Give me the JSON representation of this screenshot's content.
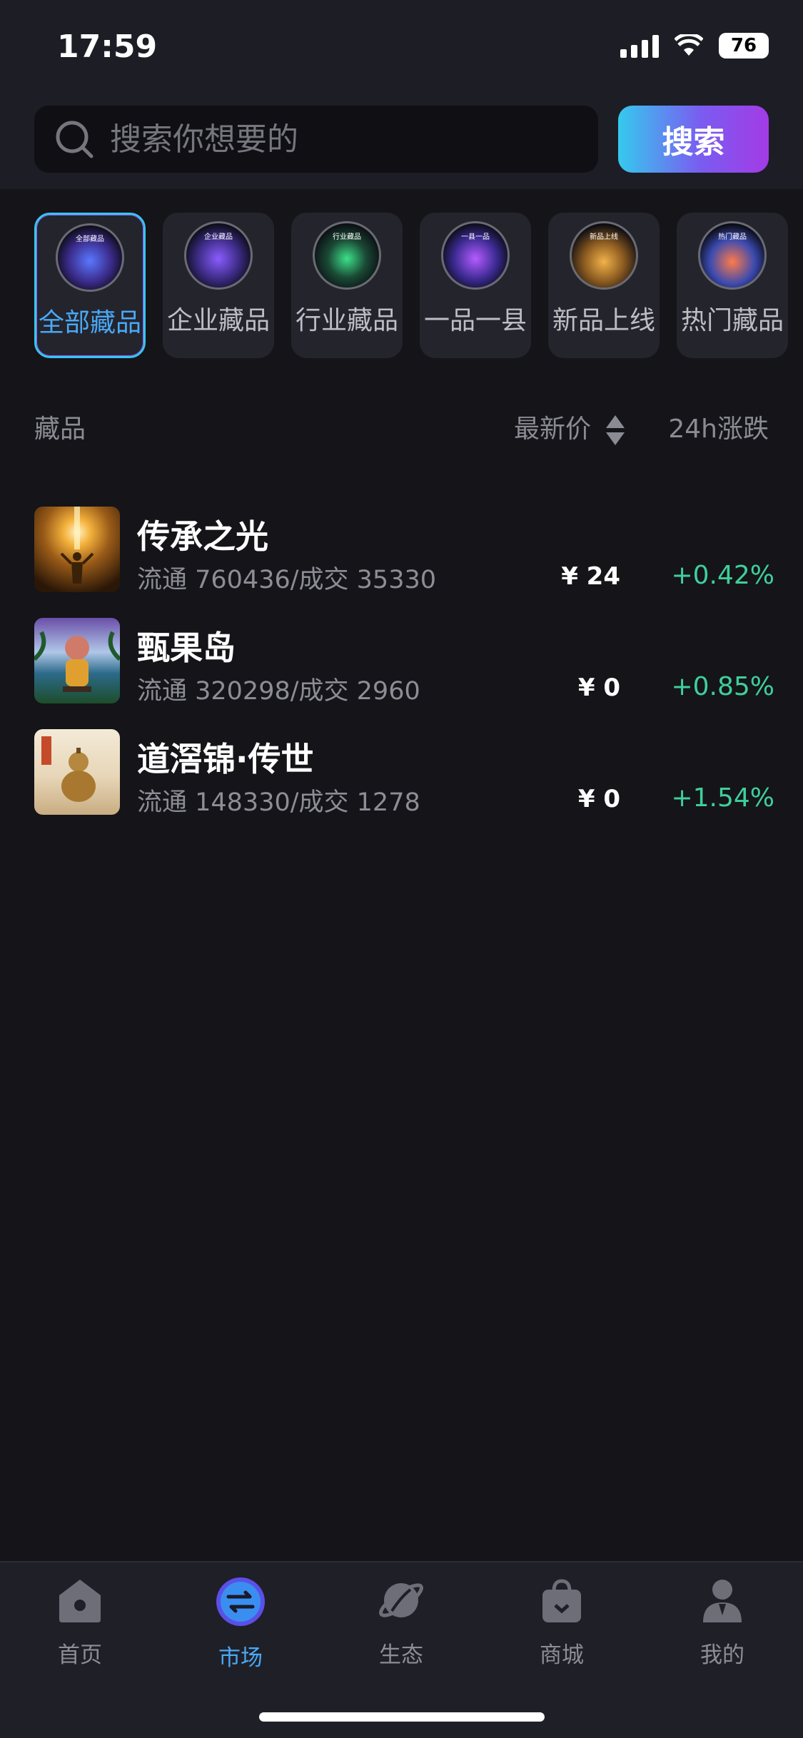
{
  "status_bar": {
    "time": "17:59",
    "battery": "76"
  },
  "search": {
    "placeholder": "搜索你想要的",
    "value": "",
    "button_label": "搜索"
  },
  "categories": [
    {
      "label": "全部藏品",
      "badge": "全部藏品",
      "active": true
    },
    {
      "label": "企业藏品",
      "badge": "企业藏品",
      "active": false
    },
    {
      "label": "行业藏品",
      "badge": "行业藏品",
      "active": false
    },
    {
      "label": "一品一县",
      "badge": "一县一品",
      "active": false
    },
    {
      "label": "新品上线",
      "badge": "新品上线",
      "active": false
    },
    {
      "label": "热门藏品",
      "badge": "热门藏品",
      "active": false
    }
  ],
  "list_header": {
    "name_col": "藏品",
    "price_col": "最新价",
    "change_col": "24h涨跌"
  },
  "items": [
    {
      "title": "传承之光",
      "circulation": "流通 760436/成交 35330",
      "price": "¥ 24",
      "change": "+0.42%"
    },
    {
      "title": "甄果岛",
      "circulation": "流通 320298/成交 2960",
      "price": "¥ 0",
      "change": "+0.85%"
    },
    {
      "title": "道滘锦·传世",
      "circulation": "流通 148330/成交 1278",
      "price": "¥ 0",
      "change": "+1.54%"
    }
  ],
  "tabbar": [
    {
      "label": "首页",
      "icon": "home-icon",
      "active": false
    },
    {
      "label": "市场",
      "icon": "market-icon",
      "active": true
    },
    {
      "label": "生态",
      "icon": "planet-icon",
      "active": false
    },
    {
      "label": "商城",
      "icon": "shopping-bag-icon",
      "active": false
    },
    {
      "label": "我的",
      "icon": "profile-icon",
      "active": false
    }
  ],
  "colors": {
    "accent_blue": "#4aa8f5",
    "gain_green": "#3fcf9a",
    "bg": "#141419"
  }
}
